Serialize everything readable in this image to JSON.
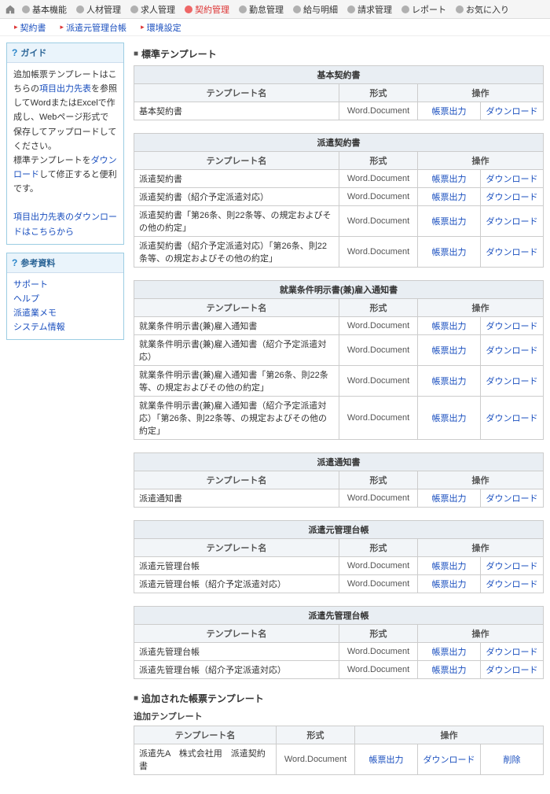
{
  "topnav": [
    {
      "label": "基本機能"
    },
    {
      "label": "人材管理"
    },
    {
      "label": "求人管理"
    },
    {
      "label": "契約管理",
      "active": true
    },
    {
      "label": "勤怠管理"
    },
    {
      "label": "給与明細"
    },
    {
      "label": "請求管理"
    },
    {
      "label": "レポート"
    },
    {
      "label": "お気に入り"
    }
  ],
  "subnav": [
    {
      "label": "契約書"
    },
    {
      "label": "派遣元管理台帳"
    },
    {
      "label": "環境設定"
    }
  ],
  "guide": {
    "title": "ガイド",
    "text_parts": {
      "p1a": "追加帳票テンプレートはこちらの",
      "p1b": "項目出力先表",
      "p1c": "を参照してWordまたはExcelで作成し、Webページ形式で保存してアップロードしてください。",
      "p2a": "標準テンプレートを",
      "p2b": "ダウンロード",
      "p2c": "して修正すると便利です。"
    },
    "dl_link": "項目出力先表のダウンロードはこちらから"
  },
  "ref": {
    "title": "参考資料",
    "items": [
      "サポート",
      "ヘルプ",
      "派遣業メモ",
      "システム情報"
    ]
  },
  "labels": {
    "standard": "標準テンプレート",
    "added": "追加された帳票テンプレート",
    "added_sub": "追加テンプレート",
    "col_name": "テンプレート名",
    "col_fmt": "形式",
    "col_act": "操作",
    "out": "帳票出力",
    "dl": "ダウンロード",
    "del": "削除",
    "fmt": "Word.Document"
  },
  "groups": [
    {
      "title": "基本契約書",
      "rows": [
        {
          "name": "基本契約書"
        }
      ]
    },
    {
      "title": "派遣契約書",
      "rows": [
        {
          "name": "派遣契約書"
        },
        {
          "name": "派遣契約書（紹介予定派遣対応）"
        },
        {
          "name": "派遣契約書「第26条、則22条等、の規定およびその他の約定」"
        },
        {
          "name": "派遣契約書（紹介予定派遣対応）「第26条、則22条等、の規定およびその他の約定」"
        }
      ]
    },
    {
      "title": "就業条件明示書(兼)雇入通知書",
      "rows": [
        {
          "name": "就業条件明示書(兼)雇入通知書"
        },
        {
          "name": "就業条件明示書(兼)雇入通知書（紹介予定派遣対応）"
        },
        {
          "name": "就業条件明示書(兼)雇入通知書「第26条、則22条等、の規定およびその他の約定」"
        },
        {
          "name": "就業条件明示書(兼)雇入通知書（紹介予定派遣対応）「第26条、則22条等、の規定およびその他の約定」"
        }
      ]
    },
    {
      "title": "派遣通知書",
      "rows": [
        {
          "name": "派遣通知書"
        }
      ]
    },
    {
      "title": "派遣元管理台帳",
      "rows": [
        {
          "name": "派遣元管理台帳"
        },
        {
          "name": "派遣元管理台帳（紹介予定派遣対応）"
        }
      ]
    },
    {
      "title": "派遣先管理台帳",
      "rows": [
        {
          "name": "派遣先管理台帳"
        },
        {
          "name": "派遣先管理台帳（紹介予定派遣対応）"
        }
      ]
    }
  ],
  "added_group": {
    "title": "",
    "rows": [
      {
        "name": "派遣先A　株式会社用　派遣契約書"
      }
    ]
  }
}
